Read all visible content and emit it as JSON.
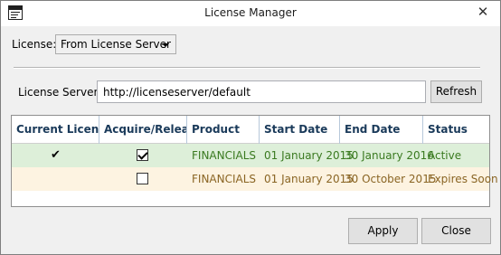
{
  "window": {
    "title": "License Manager",
    "close_glyph": "✕",
    "icon": "app-window-icon"
  },
  "license": {
    "label": "License:",
    "selected": "From License Server"
  },
  "server": {
    "label": "License Server:",
    "value": "http://licenseserver/default",
    "refresh_label": "Refresh"
  },
  "table": {
    "columns": [
      "Current License",
      "Acquire/Release",
      "Product",
      "Start Date",
      "End Date",
      "Status"
    ],
    "rows": [
      {
        "current": true,
        "current_glyph": "✔",
        "acquire": true,
        "product": "FINANCIALS",
        "start": "01 January 2015",
        "end": "30 January 2016",
        "status": "Active"
      },
      {
        "current": false,
        "current_glyph": "",
        "acquire": false,
        "product": "FINANCIALS",
        "start": "01 January 2015",
        "end": "30 October 2015",
        "status": "Expires Soon"
      }
    ]
  },
  "footer": {
    "apply_label": "Apply",
    "close_label": "Close"
  },
  "colors": {
    "active_row_bg": "#ddefd9",
    "active_row_text": "#3a7a20",
    "expiring_row_bg": "#fdf3e1",
    "expiring_row_text": "#8a6524",
    "header_text": "#1a3a5a"
  }
}
